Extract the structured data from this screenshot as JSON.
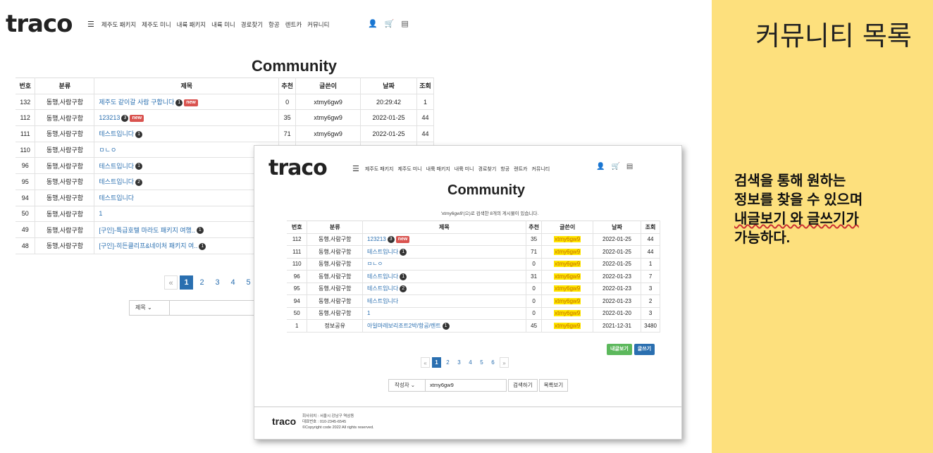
{
  "brand": "traco",
  "nav": {
    "items": [
      "제주도 패키지",
      "제주도 미니",
      "내륙 패키지",
      "내륙 미니",
      "경로찾기",
      "항공",
      "렌트카",
      "커뮤니티"
    ]
  },
  "icons": [
    "user-icon",
    "cart-icon",
    "list-icon"
  ],
  "back_page": {
    "title": "Community",
    "columns": [
      "번호",
      "분류",
      "제목",
      "추천",
      "글쓴이",
      "날짜",
      "조회"
    ],
    "rows": [
      {
        "no": "132",
        "cat": "동행,사람구함",
        "title": "제주도 같이갈 사람 구합니다",
        "count": "1",
        "new": true,
        "rec": "0",
        "author": "xtmy6gw9",
        "date": "20:29:42",
        "views": "1"
      },
      {
        "no": "112",
        "cat": "동행,사람구함",
        "title": "123213",
        "count": "3",
        "new": true,
        "rec": "35",
        "author": "xtmy6gw9",
        "date": "2022-01-25",
        "views": "44"
      },
      {
        "no": "111",
        "cat": "동행,사람구함",
        "title": "테스트입니다",
        "count": "1",
        "new": false,
        "rec": "71",
        "author": "xtmy6gw9",
        "date": "2022-01-25",
        "views": "44"
      },
      {
        "no": "110",
        "cat": "동행,사람구함",
        "title": "ㅁㄴㅇ",
        "count": "",
        "new": false,
        "rec": "",
        "author": "",
        "date": "",
        "views": ""
      },
      {
        "no": "96",
        "cat": "동행,사람구함",
        "title": "테스트입니다",
        "count": "1",
        "new": false,
        "rec": "",
        "author": "",
        "date": "",
        "views": ""
      },
      {
        "no": "95",
        "cat": "동행,사람구함",
        "title": "테스트입니다",
        "count": "2",
        "new": false,
        "rec": "",
        "author": "",
        "date": "",
        "views": ""
      },
      {
        "no": "94",
        "cat": "동행,사람구함",
        "title": "테스트입니다",
        "count": "",
        "new": false,
        "rec": "",
        "author": "",
        "date": "",
        "views": ""
      },
      {
        "no": "50",
        "cat": "동행,사람구함",
        "title": "1",
        "count": "",
        "new": false,
        "rec": "",
        "author": "",
        "date": "",
        "views": ""
      },
      {
        "no": "49",
        "cat": "동행,사람구함",
        "title": "[구인]-특급호텔 마라도 패키지 여행..",
        "count": "1",
        "new": false,
        "rec": "",
        "author": "",
        "date": "",
        "views": ""
      },
      {
        "no": "48",
        "cat": "동행,사람구함",
        "title": "[구인]-히든클리프&네이처 패키지 여..",
        "count": "1",
        "new": false,
        "rec": "",
        "author": "",
        "date": "",
        "views": ""
      }
    ],
    "pager": [
      "«",
      "1",
      "2",
      "3",
      "4",
      "5",
      "6"
    ],
    "search_select": "제목"
  },
  "front_page": {
    "title": "Community",
    "subtitle": "'xtmy6gw9'(으)로 검색한 8개의 게시물이 있습니다.",
    "columns": [
      "번호",
      "분류",
      "제목",
      "추천",
      "글쓴이",
      "날짜",
      "조회"
    ],
    "rows": [
      {
        "no": "112",
        "cat": "동행,사람구함",
        "title": "123213",
        "count": "3",
        "new": true,
        "rec": "35",
        "author": "xtmy6gw9",
        "date": "2022-01-25",
        "views": "44"
      },
      {
        "no": "111",
        "cat": "동행,사람구함",
        "title": "테스트입니다",
        "count": "1",
        "new": false,
        "rec": "71",
        "author": "xtmy6gw9",
        "date": "2022-01-25",
        "views": "44"
      },
      {
        "no": "110",
        "cat": "동행,사람구함",
        "title": "ㅁㄴㅇ",
        "count": "",
        "new": false,
        "rec": "0",
        "author": "xtmy6gw9",
        "date": "2022-01-25",
        "views": "1"
      },
      {
        "no": "96",
        "cat": "동행,사람구함",
        "title": "테스트입니다",
        "count": "1",
        "new": false,
        "rec": "31",
        "author": "xtmy6gw9",
        "date": "2022-01-23",
        "views": "7"
      },
      {
        "no": "95",
        "cat": "동행,사람구함",
        "title": "테스트입니다",
        "count": "2",
        "new": false,
        "rec": "0",
        "author": "xtmy6gw9",
        "date": "2022-01-23",
        "views": "3"
      },
      {
        "no": "94",
        "cat": "동행,사람구함",
        "title": "테스트입니다",
        "count": "",
        "new": false,
        "rec": "0",
        "author": "xtmy6gw9",
        "date": "2022-01-23",
        "views": "2"
      },
      {
        "no": "50",
        "cat": "동행,사람구함",
        "title": "1",
        "count": "",
        "new": false,
        "rec": "0",
        "author": "xtmy6gw9",
        "date": "2022-01-20",
        "views": "3"
      },
      {
        "no": "1",
        "cat": "정보공유",
        "title": "아일마레보리조트2박/항공/렌트",
        "count": "1",
        "new": false,
        "rec": "45",
        "author": "xtmy6gw9",
        "date": "2021-12-31",
        "views": "3480"
      }
    ],
    "my_posts_label": "내글보기",
    "write_label": "글쓰기",
    "pager": [
      "«",
      "1",
      "2",
      "3",
      "4",
      "5",
      "6",
      "»"
    ],
    "search_select": "작성자",
    "search_value": "xtmy6gw9",
    "search_button": "검색하기",
    "list_button": "목록보기",
    "footer": {
      "logo": "traco",
      "lines": [
        "회사위치 : 서울시 강남구 역삼동",
        "대표번호 : 010-2345-6545",
        "©Copyright code 2022 All rights reserved."
      ]
    }
  },
  "panel": {
    "title": "커뮤니티 목록",
    "desc_lines": [
      "검색을 통해 원하는",
      "정보를 찾을 수 있으며",
      "내글보기 와 글쓰기가",
      "가능하다."
    ],
    "bg_color": "#fde07d"
  },
  "new_badge": "new",
  "colors": {
    "accent": "#2a6fb0",
    "highlight": "#ffe600",
    "new_badge": "#d9534f",
    "my_posts": "#5cb85c"
  }
}
